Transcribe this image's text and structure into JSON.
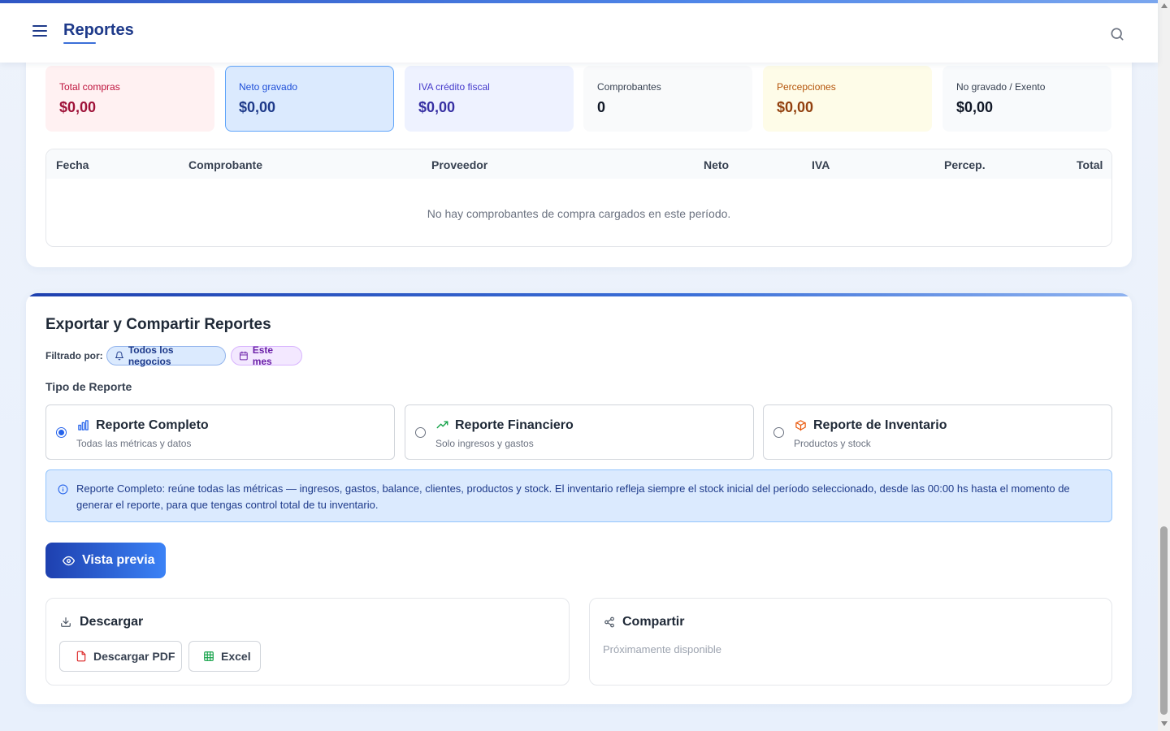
{
  "header": {
    "title": "Reportes",
    "menu_icon": "hamburger-menu-icon",
    "search_icon": "search-icon"
  },
  "summary": {
    "metrics": [
      {
        "label": "Total compras",
        "value": "$0,00",
        "label_color": "#be123c",
        "value_color": "#9f1239",
        "bg": "#fff1f2",
        "border": "#fff1f2"
      },
      {
        "label": "Neto gravado",
        "value": "$0,00",
        "label_color": "#1d4ed8",
        "value_color": "#1e3a8a",
        "bg": "#dbeafe",
        "border": "#60a5fa"
      },
      {
        "label": "IVA crédito fiscal",
        "value": "$0,00",
        "label_color": "#4338ca",
        "value_color": "#3730a3",
        "bg": "#eef2ff",
        "border": "#eef2ff"
      },
      {
        "label": "Comprobantes",
        "value": "0",
        "label_color": "#374151",
        "value_color": "#111827",
        "bg": "#f9fafb",
        "border": "#f9fafb"
      },
      {
        "label": "Percepciones",
        "value": "$0,00",
        "label_color": "#b45309",
        "value_color": "#92400e",
        "bg": "#fefce8",
        "border": "#fefce8"
      },
      {
        "label": "No gravado / Exento",
        "value": "$0,00",
        "label_color": "#374151",
        "value_color": "#111827",
        "bg": "#f8fafc",
        "border": "#f8fafc"
      }
    ],
    "table": {
      "columns": [
        "Fecha",
        "Comprobante",
        "Proveedor",
        "Neto",
        "IVA",
        "Percep.",
        "Total"
      ],
      "empty_message": "No hay comprobantes de compra cargados en este período."
    }
  },
  "export": {
    "title": "Exportar y Compartir Reportes",
    "filter_label": "Filtrado por:",
    "chips": {
      "business": "Todos los negocios",
      "period": "Este mes"
    },
    "type_label": "Tipo de Reporte",
    "report_types": [
      {
        "title": "Reporte Completo",
        "subtitle": "Todas las métricas y datos",
        "icon": "bar-chart-icon",
        "icon_color": "#2563eb",
        "selected": true
      },
      {
        "title": "Reporte Financiero",
        "subtitle": "Solo ingresos y gastos",
        "icon": "trending-up-icon",
        "icon_color": "#16a34a",
        "selected": false
      },
      {
        "title": "Reporte de Inventario",
        "subtitle": "Productos y stock",
        "icon": "package-icon",
        "icon_color": "#ea580c",
        "selected": false
      }
    ],
    "info_text": "Reporte Completo: reúne todas las métricas — ingresos, gastos, balance, clientes, productos y stock. El inventario refleja siempre el stock inicial del período seleccionado, desde las 00:00 hs hasta el momento de generar el reporte, para que tengas control total de tu inventario.",
    "preview_button": "Vista previa",
    "download": {
      "title": "Descargar",
      "pdf_button": "Descargar PDF",
      "excel_button": "Excel"
    },
    "share": {
      "title": "Compartir",
      "status": "Próximamente disponible"
    }
  }
}
